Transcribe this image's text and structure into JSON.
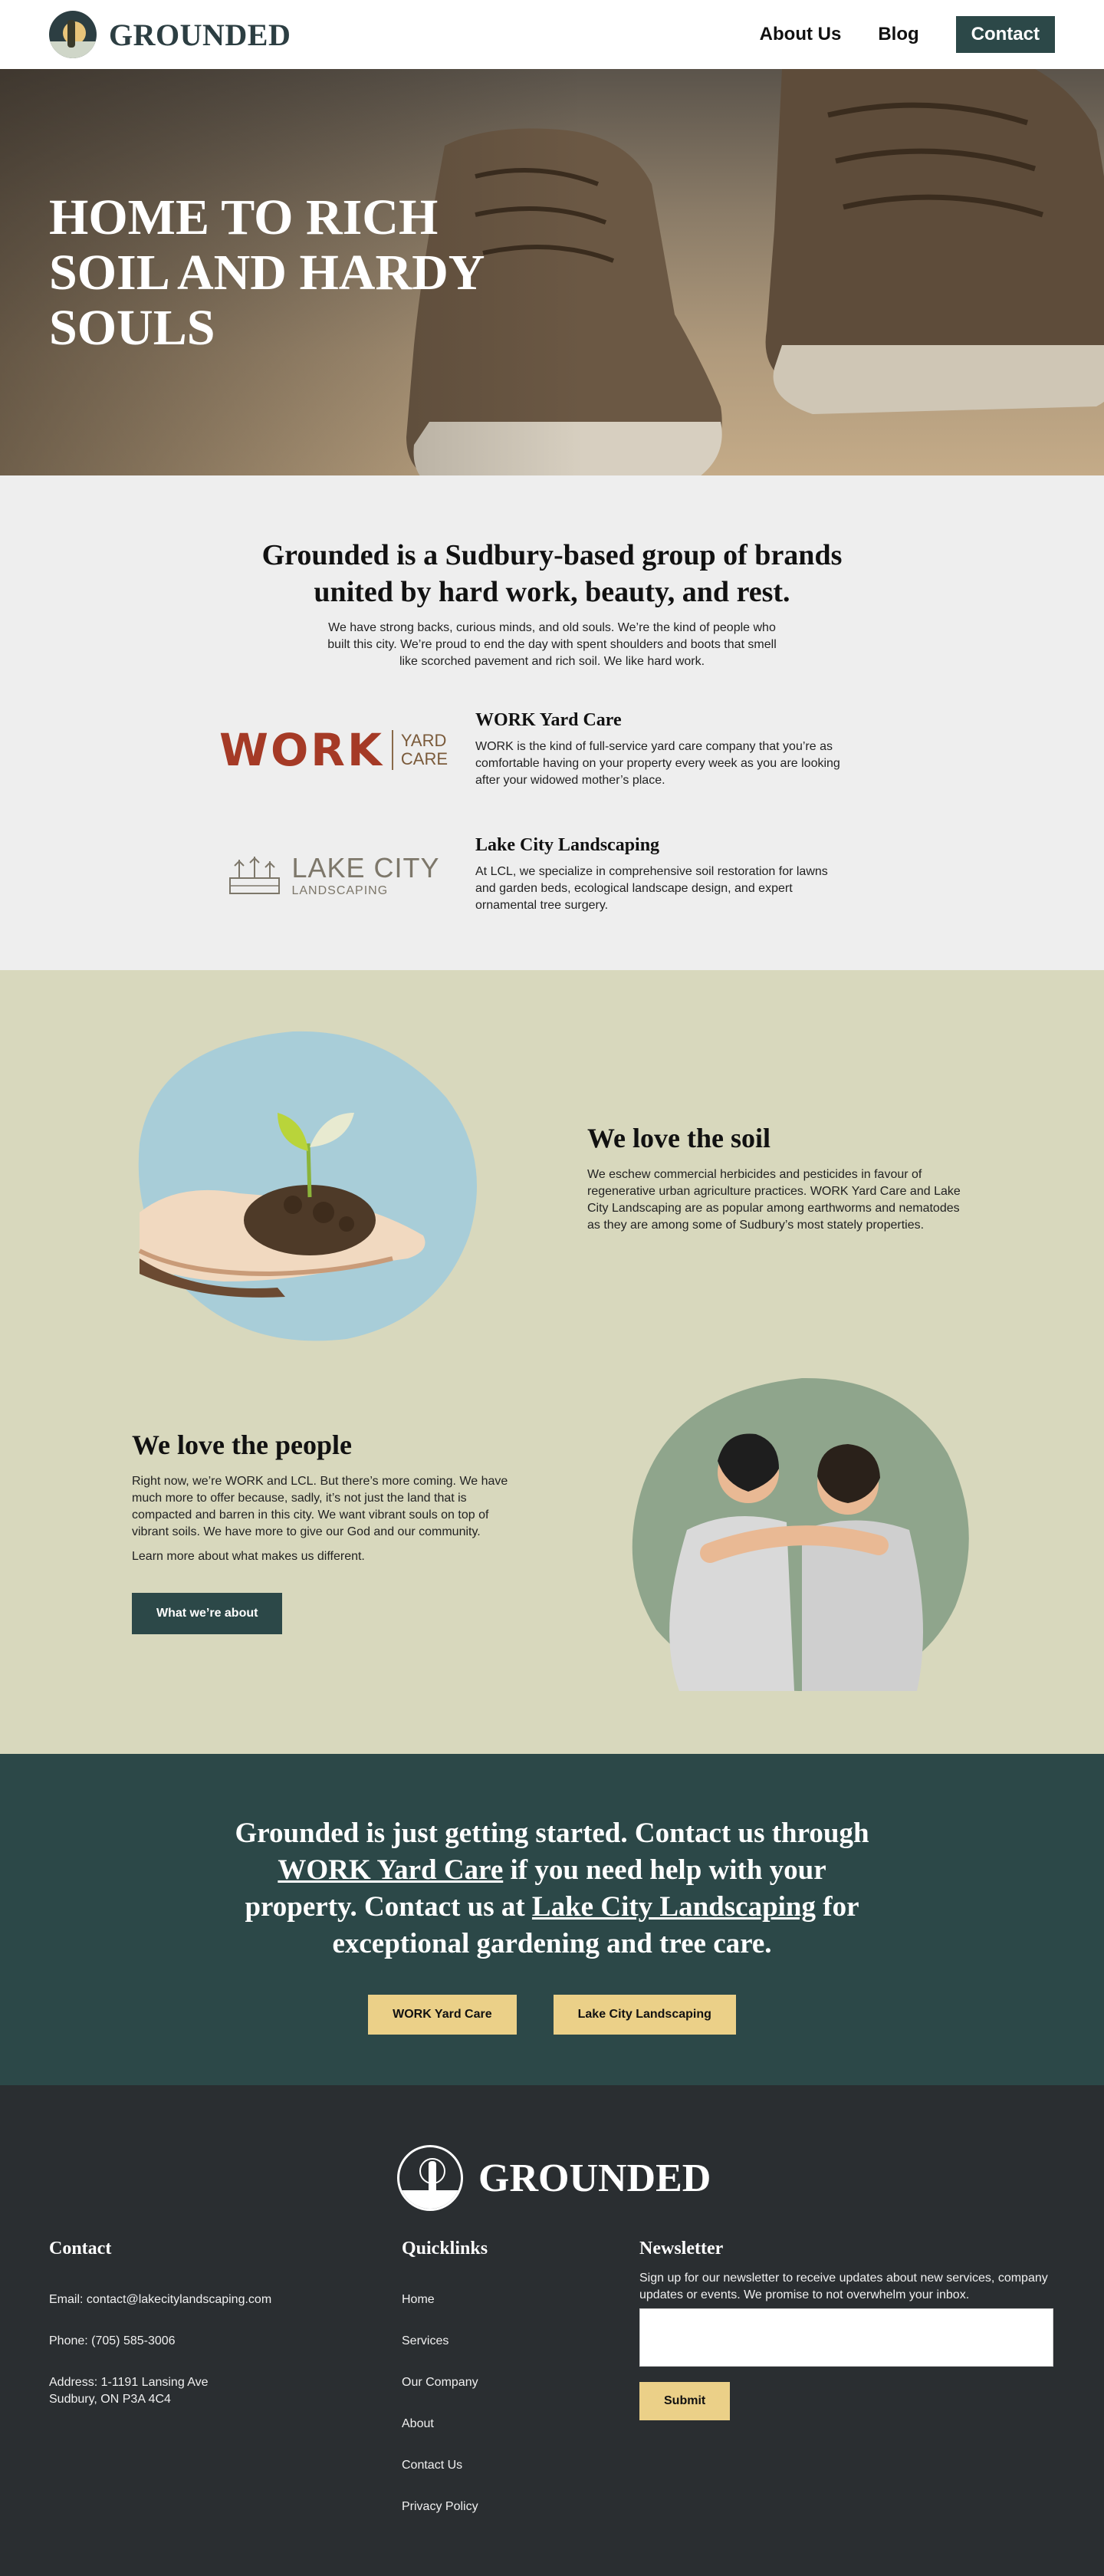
{
  "header": {
    "brand_name": "GROUNDED",
    "nav": {
      "about": "About Us",
      "blog": "Blog",
      "contact": "Contact"
    }
  },
  "hero": {
    "title": "HOME TO RICH SOIL AND HARDY SOULS"
  },
  "intro": {
    "title": "Grounded is a Sudbury-based group of brands united by hard work, beauty, and rest.",
    "text": "We have strong backs, curious minds, and old souls. We’re the kind of people who built this city. We’re proud to end the day with spent shoulders and boots that smell like scorched pavement and rich soil. We like hard work.",
    "brands": [
      {
        "logo_word": "WORK",
        "logo_sub_1": "YARD",
        "logo_sub_2": "CARE",
        "name": "WORK Yard Care",
        "description": "WORK is the kind of full-service yard care company that you’re as comfortable having on your property every week as you are looking after your widowed mother’s place."
      },
      {
        "logo_word": "LAKE CITY",
        "logo_sub": "LANDSCAPING",
        "name": "Lake City Landscaping",
        "description": "At LCL, we specialize in comprehensive soil restoration for lawns and garden beds, ecological landscape design, and expert ornamental tree surgery."
      }
    ]
  },
  "values": {
    "soil": {
      "title": "We love the soil",
      "text": "We eschew commercial herbicides and pesticides in favour of regenerative urban agriculture practices. WORK Yard Care and Lake City Landscaping are as popular among earthworms and nematodes as they are among some of Sudbury’s most stately properties."
    },
    "people": {
      "title": "We love the people",
      "text": "Right now, we’re WORK and LCL. But there’s more coming. We have much more to offer because, sadly, it’s not just the land that is compacted and barren in this city. We want vibrant souls on top of vibrant soils. We have more to give our God and our community.",
      "text2": "Learn more about what makes us different.",
      "button": "What we’re about"
    }
  },
  "cta": {
    "part1": "Grounded is just getting started. Contact us through ",
    "link1": "WORK Yard Care",
    "part2": " if you need help with your property. Contact us at ",
    "link2": "Lake City Landscaping",
    "part3": " for exceptional gardening and tree care.",
    "button1": "WORK Yard Care",
    "button2": "Lake City Landscaping"
  },
  "footer": {
    "brand_name": "GROUNDED",
    "contact": {
      "title": "Contact",
      "email": "Email: contact@lakecitylandscaping.com",
      "phone": "Phone: (705) 585-3006",
      "address_1": "Address: 1-1191 Lansing Ave",
      "address_2": "Sudbury, ON P3A 4C4"
    },
    "quicklinks": {
      "title": "Quicklinks",
      "items": [
        "Home",
        "Services",
        "Our Company",
        "About",
        "Contact Us",
        "Privacy Policy"
      ]
    },
    "newsletter": {
      "title": "Newsletter",
      "text": "Sign up for our newsletter to receive updates about new services, company updates or events. We promise to not overwhelm your inbox.",
      "input_value": "",
      "submit": "Submit"
    }
  },
  "colors": {
    "accent_dark": "#2c4848",
    "accent_yellow": "#ebd088",
    "soil_bg": "#d8d8bd",
    "footer_bg": "#2a2e31",
    "work_red": "#a53a26"
  }
}
